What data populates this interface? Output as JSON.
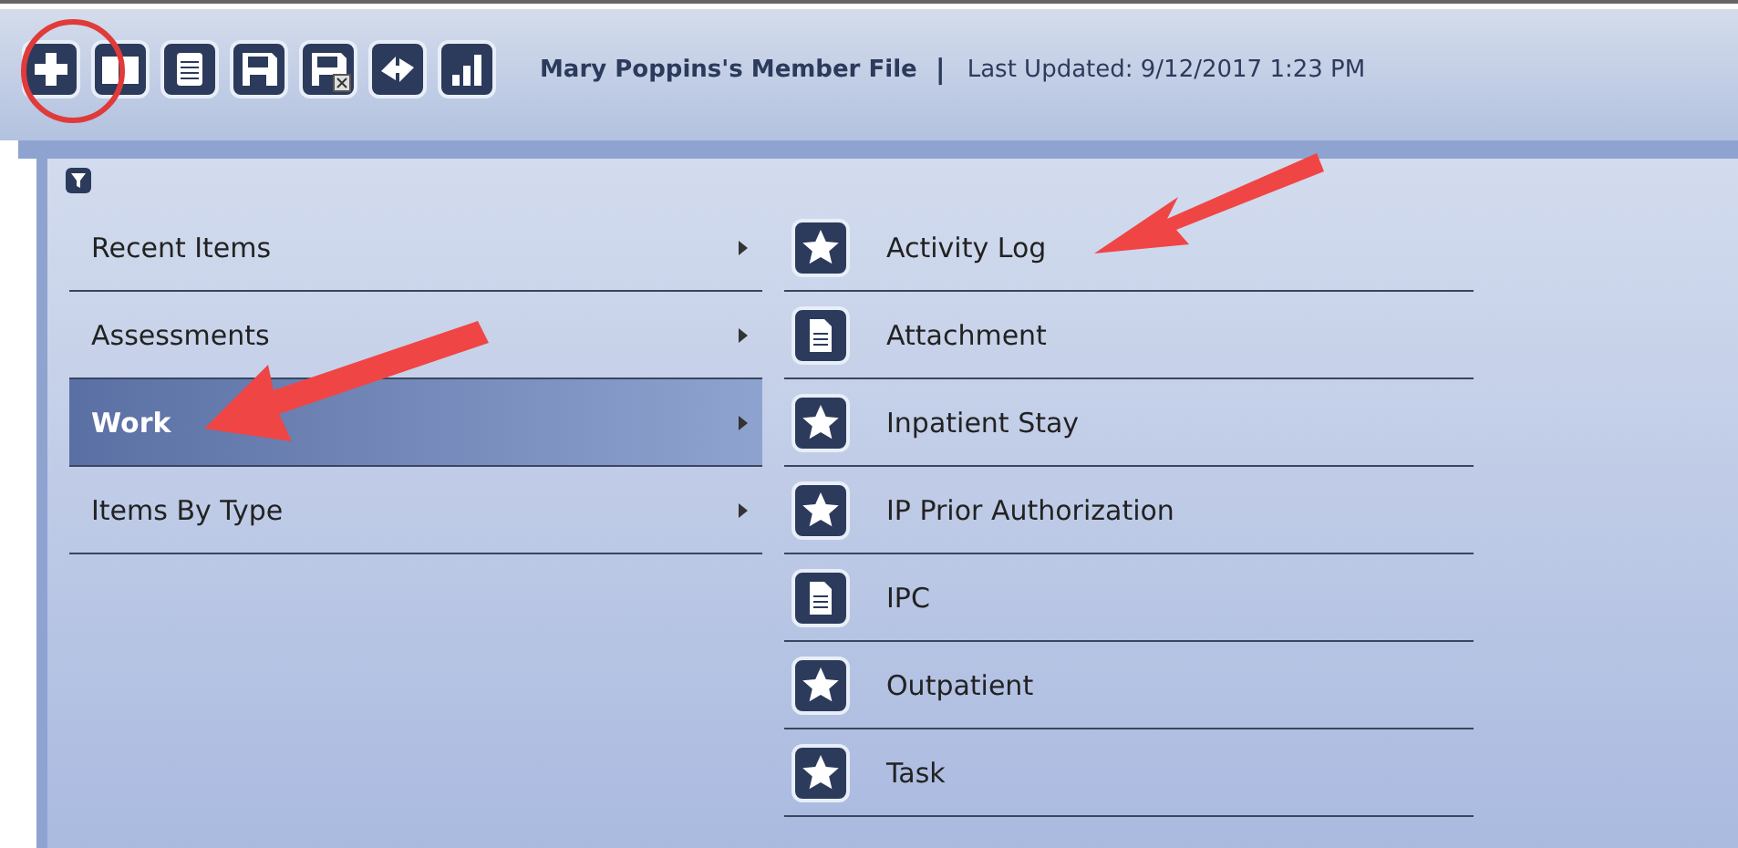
{
  "toolbar": {
    "buttons": [
      {
        "kind": "add"
      },
      {
        "kind": "book"
      },
      {
        "kind": "notepad"
      },
      {
        "kind": "save"
      },
      {
        "kind": "save-close"
      },
      {
        "kind": "sync"
      },
      {
        "kind": "chart"
      }
    ]
  },
  "header": {
    "title": "Mary Poppins's Member File",
    "separator": "|",
    "last_updated": "Last Updated: 9/12/2017 1:23 PM"
  },
  "menu": {
    "items": [
      {
        "label": "Recent Items",
        "selected": false
      },
      {
        "label": "Assessments",
        "selected": false
      },
      {
        "label": "Work",
        "selected": true
      },
      {
        "label": "Items By Type",
        "selected": false
      }
    ]
  },
  "submenu": {
    "items": [
      {
        "label": "Activity Log",
        "kind": "star"
      },
      {
        "label": "Attachment",
        "kind": "document"
      },
      {
        "label": "Inpatient Stay",
        "kind": "star"
      },
      {
        "label": "IP Prior Authorization",
        "kind": "star"
      },
      {
        "label": "IPC",
        "kind": "document"
      },
      {
        "label": "Outpatient",
        "kind": "star"
      },
      {
        "label": "Task",
        "kind": "star"
      }
    ]
  }
}
